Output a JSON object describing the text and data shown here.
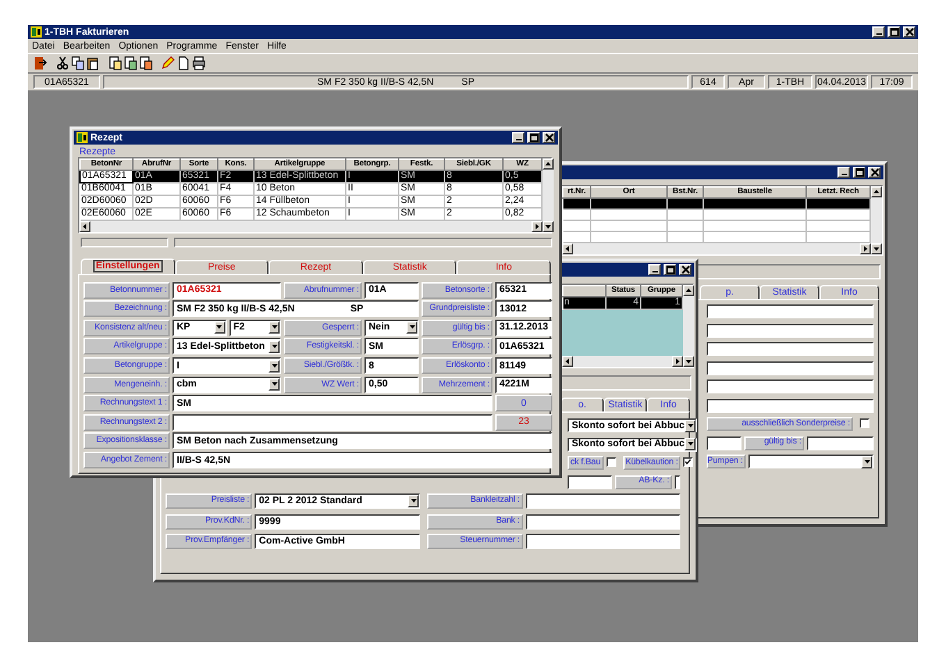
{
  "app": {
    "title": "1-TBH Fakturieren",
    "menu": [
      "Datei",
      "Bearbeiten",
      "Optionen",
      "Programme",
      "Fenster",
      "Hilfe"
    ],
    "status_bar": [
      [
        "01A65321"
      ],
      [
        "SM F2 350 kg  II/B-S 42,5N",
        "SP"
      ],
      [
        "614"
      ],
      [
        "Apr"
      ],
      [
        "1-TBH"
      ],
      [
        "04.04.2013"
      ],
      [
        "17:09"
      ]
    ]
  },
  "back_window": {
    "columns": [
      "rt.Nr.",
      "Ort",
      "Bst.Nr.",
      "Baustelle",
      "Letzt. Rech"
    ],
    "rows": [
      {
        "selected": true
      },
      {
        "selected": false
      },
      {
        "selected": false
      },
      {
        "selected": false
      }
    ],
    "tabs": [
      {
        "label": "p.",
        "selected": false
      },
      {
        "label": "Statistik",
        "selected": false
      },
      {
        "label": "Info",
        "selected": false
      }
    ],
    "special_prices": {
      "label": "ausschließlich Sonderpreise :",
      "checked": false
    },
    "valid_until": {
      "label": "gültig bis :"
    },
    "pumps": {
      "label": "Pumpen :"
    }
  },
  "middle_window": {
    "columns": [
      "Status",
      "Gruppe"
    ],
    "rows": [
      {
        "name_fragment": "n",
        "cells": [
          "4",
          "1"
        ],
        "selected": true
      }
    ],
    "tabs": [
      {
        "label": "o.",
        "selected": false
      },
      {
        "label": "Statistik",
        "selected": false
      },
      {
        "label": "Info",
        "selected": false
      }
    ],
    "payment_terms": [
      "Skonto sofort bei Abbuc",
      "Skonto sofort bei Abbuc"
    ],
    "checks": [
      {
        "label": "ck f.Bau",
        "checked": false
      },
      {
        "label": "Kübelkaution :",
        "checked": true
      }
    ],
    "ab_kz": {
      "label": "AB-Kz. :"
    },
    "lower_fields": [
      [
        {
          "label": "Preisliste :",
          "value": "02 PL 2  2012 Standard",
          "kind": "select"
        },
        {
          "label": "Bankleitzahl :",
          "kind": "text"
        }
      ],
      [
        {
          "label": "Prov.KdNr. :",
          "value": "9999",
          "kind": "text"
        },
        {
          "label": "Bank :",
          "kind": "text"
        }
      ],
      [
        {
          "label": "Prov.Empfänger :",
          "value": "Com-Active GmbH",
          "kind": "text"
        },
        {
          "label": "Steuernummer :",
          "kind": "text"
        }
      ]
    ]
  },
  "recipe_window": {
    "title": "Rezept",
    "group_label": "Rezepte",
    "columns": [
      "BetonNr",
      "AbrufNr",
      "Sorte",
      "Kons.",
      "Artikelgruppe",
      "Betongrp.",
      "Festk.",
      "Siebl./GK",
      "WZ"
    ],
    "rows": [
      {
        "cells": [
          "01A65321",
          "01A",
          "65321",
          "F2",
          "13 Edel-Splittbeton",
          "I",
          "SM",
          "8",
          "0,5"
        ],
        "selected": true
      },
      {
        "cells": [
          "01B60041",
          "01B",
          "60041",
          "F4",
          "10 Beton",
          "II",
          "SM",
          "8",
          "0,58"
        ],
        "selected": false
      },
      {
        "cells": [
          "02D60060",
          "02D",
          "60060",
          "F6",
          "14 Füllbeton",
          "I",
          "SM",
          "2",
          "2,24"
        ],
        "selected": false
      },
      {
        "cells": [
          "02E60060",
          "02E",
          "60060",
          "F6",
          "12 Schaumbeton",
          "I",
          "SM",
          "2",
          "0,82"
        ],
        "selected": false
      }
    ],
    "tabs": [
      {
        "label": "Einstellungen",
        "selected": true
      },
      {
        "label": "Preise",
        "selected": false
      },
      {
        "label": "Rezept",
        "selected": false
      },
      {
        "label": "Statistik",
        "selected": false
      },
      {
        "label": "Info",
        "selected": false
      }
    ],
    "fields": [
      {
        "label": "Betonnummer :",
        "value": "01A65321",
        "kind": "key"
      },
      {
        "label": "Abrufnummer :",
        "value": "01A",
        "kind": "text"
      },
      {
        "label": "Betonsorte :",
        "value": "65321",
        "kind": "text"
      },
      {
        "label": "Bezeichnung :",
        "value": "SM F2 350 kg  II/B-S 42,5N",
        "value_2": "SP",
        "kind": "wide"
      },
      {
        "label": "Grundpreisliste :",
        "value": "13012",
        "kind": "text"
      },
      {
        "label": "Konsistenz alt/neu :",
        "value": "KP",
        "value_2": "F2",
        "kind": "select_pair"
      },
      {
        "label": "Gesperrt :",
        "value": "Nein",
        "kind": "select"
      },
      {
        "label": "gültig bis :",
        "value": "31.12.2013",
        "kind": "text"
      },
      {
        "label": "Artikelgruppe :",
        "value": "13 Edel-Splittbeton",
        "kind": "select"
      },
      {
        "label": "Festigkeitskl. :",
        "value": "SM",
        "kind": "text"
      },
      {
        "label": "Erlösgrp. :",
        "value": "01A65321",
        "kind": "text"
      },
      {
        "label": "Betongruppe :",
        "value": "I",
        "kind": "select"
      },
      {
        "label": "Siebl./Größtk. :",
        "value": "8",
        "kind": "text"
      },
      {
        "label": "Erlöskonto :",
        "value": "81149",
        "kind": "text"
      },
      {
        "label": "Mengeneinh. :",
        "value": "cbm",
        "kind": "select"
      },
      {
        "label": "WZ Wert :",
        "value": "0,50",
        "kind": "text"
      },
      {
        "label": "Mehrzement :",
        "value": "4221M",
        "kind": "text"
      },
      {
        "label": "Rechnungstext 1 :",
        "value": "SM",
        "kind": "memo",
        "counter": "0",
        "counter_alert": false
      },
      {
        "label": "Rechnungstext 2 :",
        "kind": "memo",
        "counter": "23",
        "counter_alert": true
      },
      {
        "label": "Expositionsklasse :",
        "value": "SM Beton nach Zusammensetzung",
        "kind": "full"
      },
      {
        "label": "Angebot Zement :",
        "value": "II/B-S 42,5N",
        "kind": "full"
      }
    ]
  }
}
